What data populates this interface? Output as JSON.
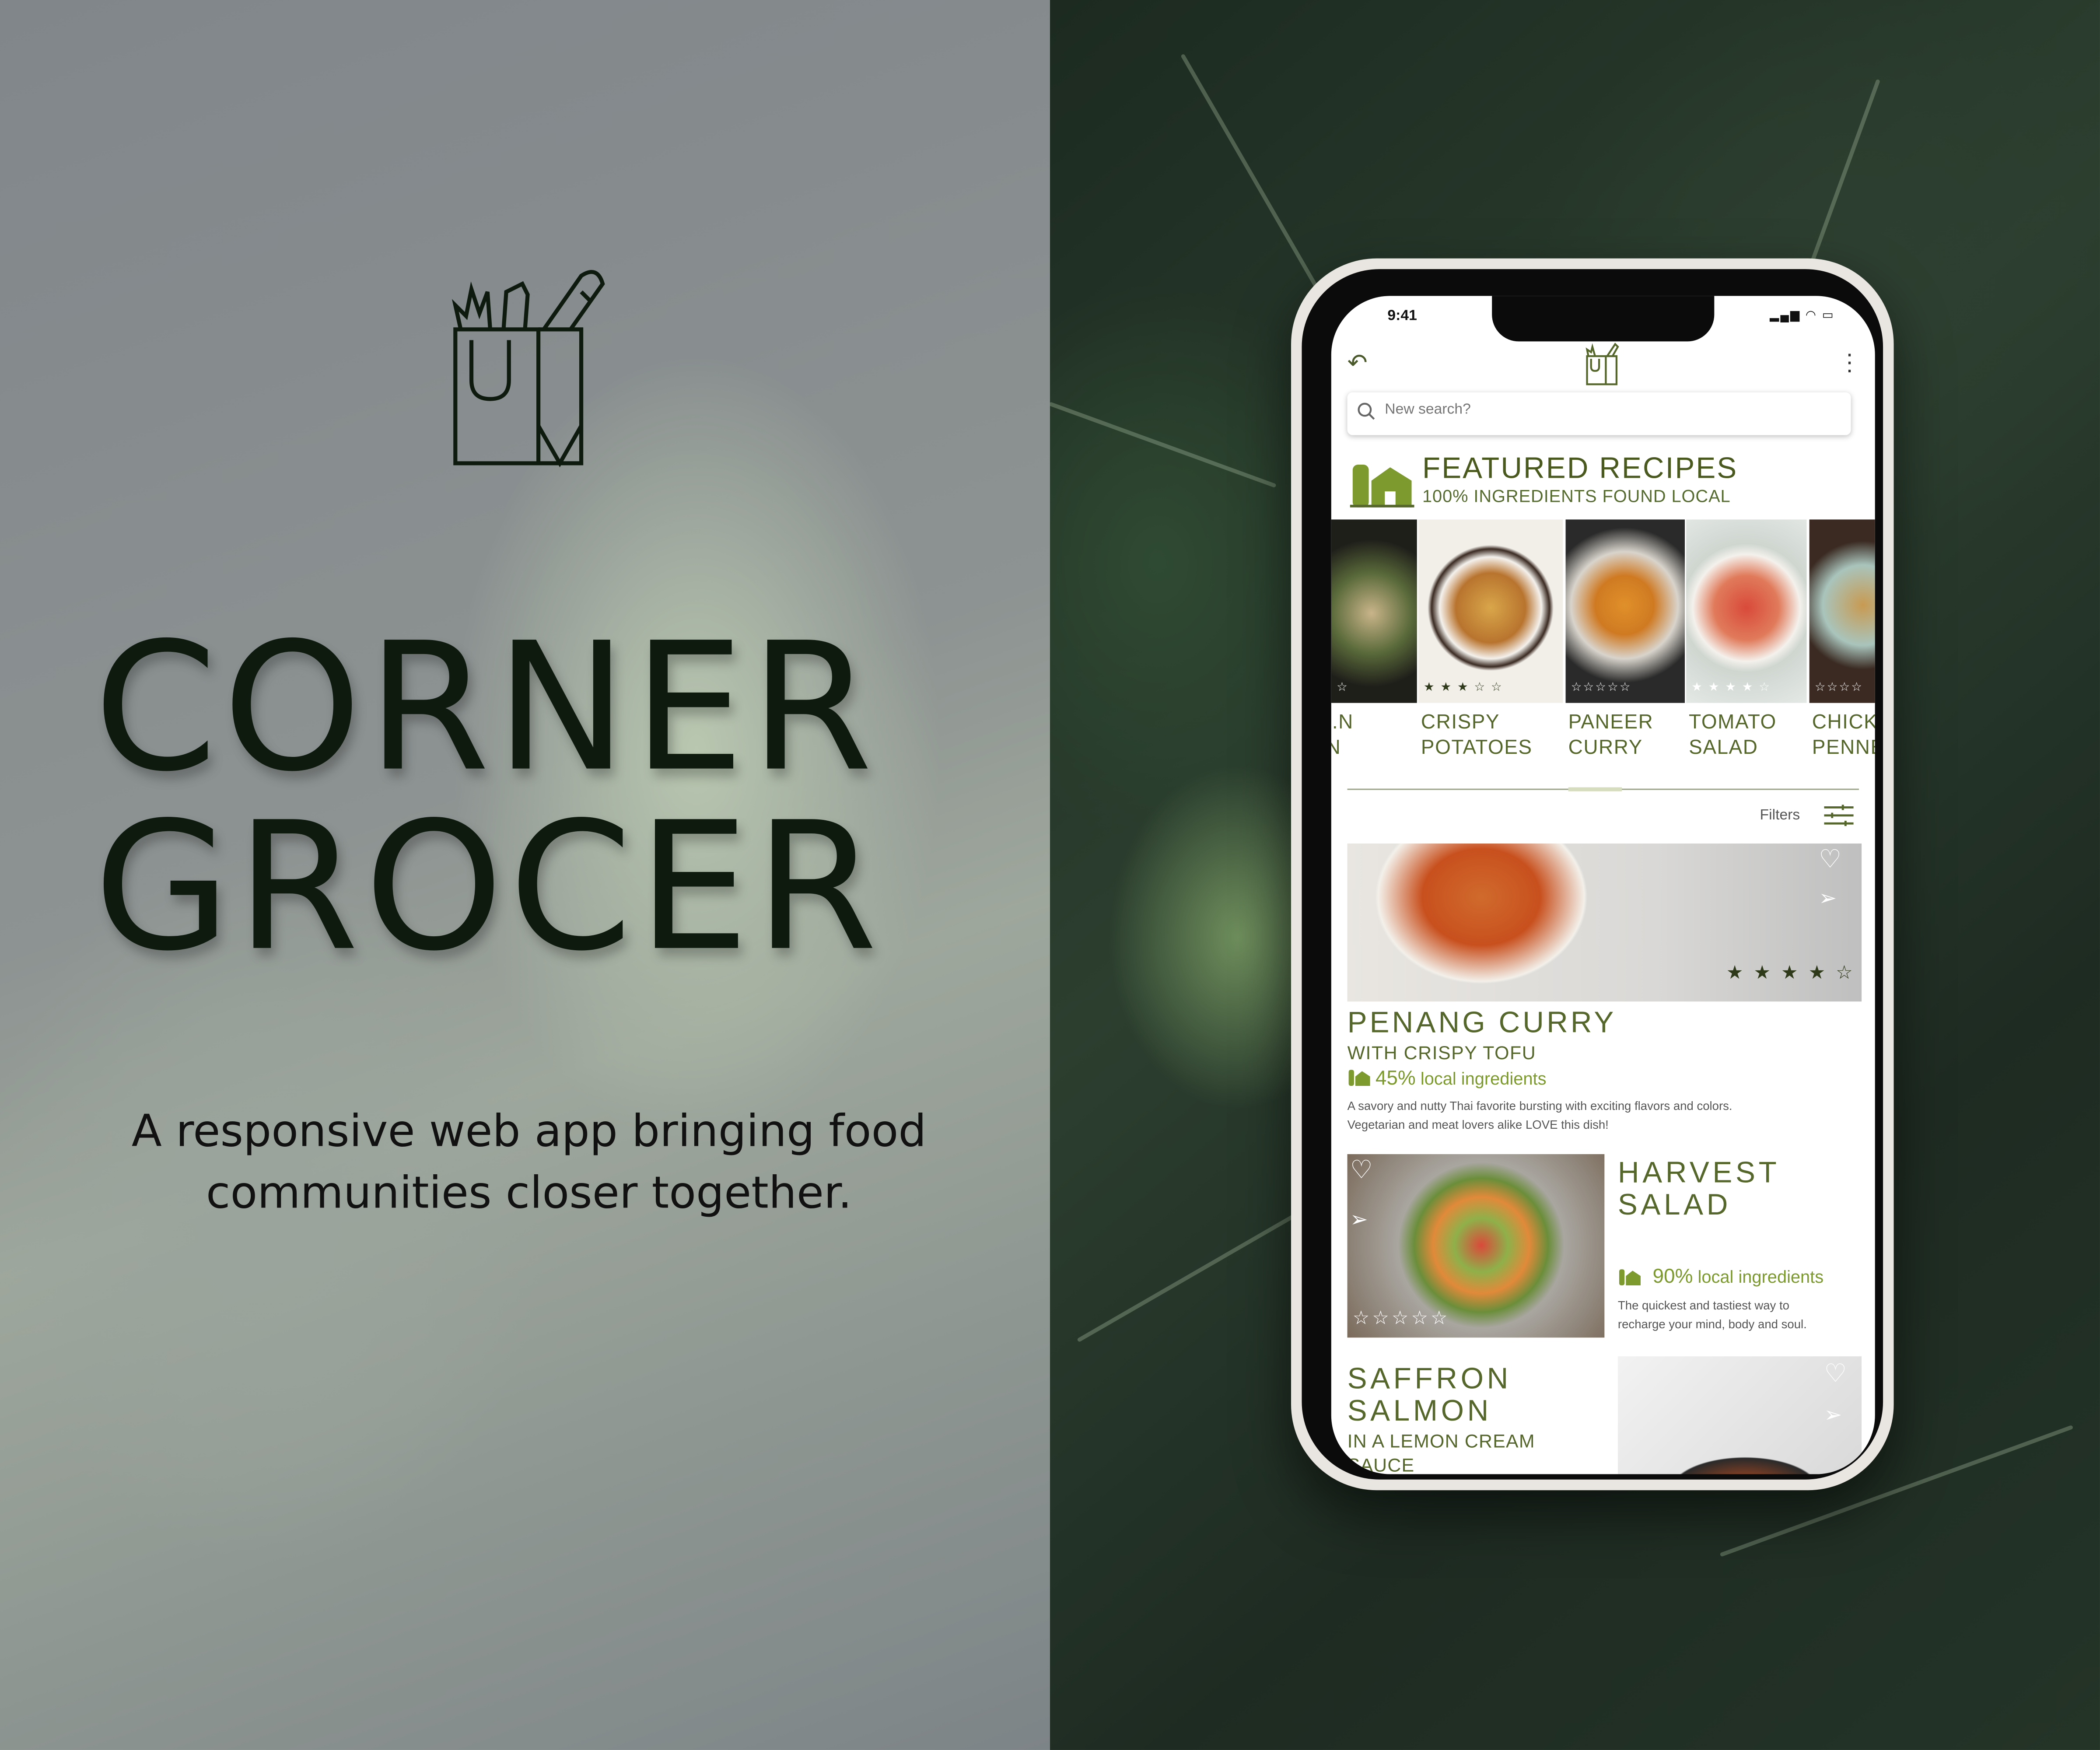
{
  "brand": {
    "title_line1": "CORNER",
    "title_line2": "GROCER",
    "tagline_line1": "A responsive web app bringing food",
    "tagline_line2": "communities closer together.",
    "logo_icon": "grocery-bag-icon"
  },
  "colors": {
    "accent_green": "#55672a",
    "local_green": "#7c9a2e",
    "dark_text": "#0f1a0f"
  },
  "phone": {
    "status": {
      "time": "9:41",
      "icons": "signal-icon wifi-icon battery-icon"
    },
    "header": {
      "back_icon": "back-arrow-icon",
      "logo_icon": "grocery-bag-icon",
      "menu_icon": "kebab-menu-icon"
    },
    "search": {
      "placeholder": "New search?",
      "icon": "search-icon"
    },
    "featured": {
      "icon": "local-market-icon",
      "title": "FEATURED RECIPES",
      "subtitle": "100% INGREDIENTS FOUND LOCAL"
    },
    "carousel": [
      {
        "label": "..N\nN",
        "stars": "☆",
        "rating": 0
      },
      {
        "label": "CRISPY\nPOTATOES",
        "stars": "★ ★ ★ ☆ ☆",
        "rating": 3
      },
      {
        "label": "PANEER\nCURRY",
        "stars": "☆☆☆☆☆",
        "rating": 0
      },
      {
        "label": "TOMATO\nSALAD",
        "stars": "★ ★ ★ ★ ☆",
        "rating": 4
      },
      {
        "label": "CHICK\nPENNE",
        "stars": "☆☆☆☆",
        "rating": 0
      }
    ],
    "filters": {
      "label": "Filters",
      "icon": "filter-sliders-icon"
    },
    "recipes": [
      {
        "title": "PENANG CURRY",
        "subtitle": "WITH CRISPY TOFU",
        "local_percent": "45%",
        "local_label": "local ingredients",
        "stars": "★ ★ ★ ★ ☆",
        "rating": 4,
        "desc_line1": "A savory and nutty Thai favorite bursting with exciting flavors and colors.",
        "desc_line2": "Vegetarian and meat lovers alike LOVE this dish!"
      },
      {
        "title": "HARVEST\nSALAD",
        "local_percent": "90%",
        "local_label": "local ingredients",
        "stars": "☆☆☆☆☆",
        "rating": 0,
        "desc_line1": "The quickest and tastiest way to",
        "desc_line2": "recharge your mind, body and soul."
      },
      {
        "title": "SAFFRON\nSALMON",
        "subtitle": "IN A LEMON CREAM\nSAUCE"
      }
    ]
  }
}
